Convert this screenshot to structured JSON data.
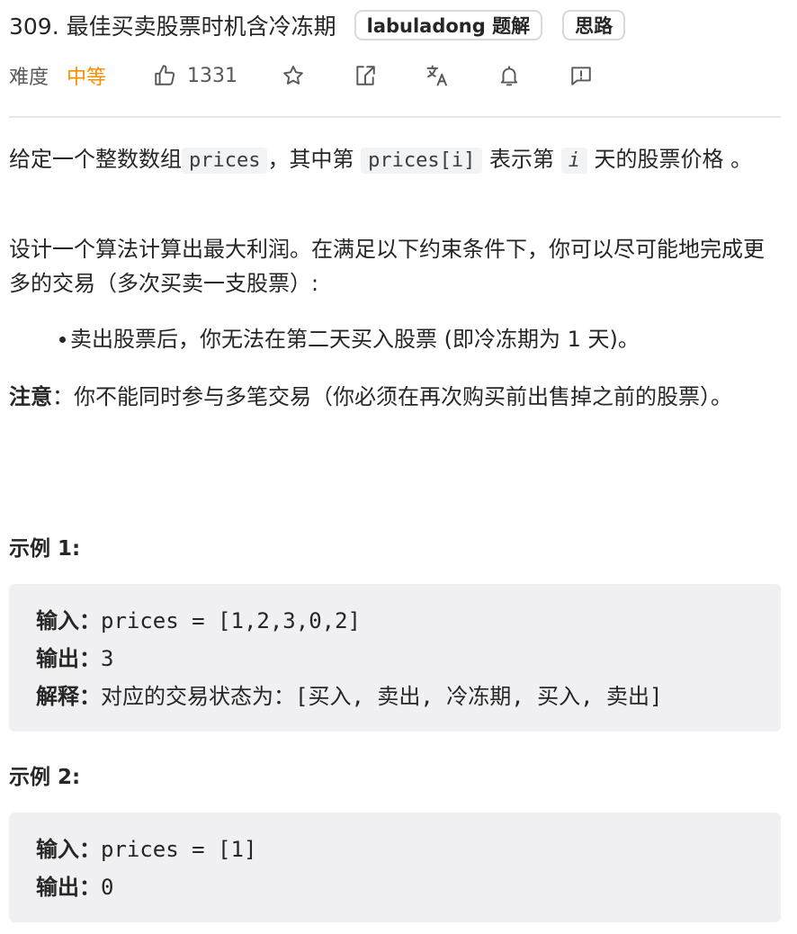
{
  "problem": {
    "title": "309. 最佳买卖股票时机含冷冻期",
    "tags": [
      "labuladong 题解",
      "思路"
    ]
  },
  "meta": {
    "difficulty_label": "难度",
    "difficulty": "中等",
    "likes": "1331",
    "accent_color": "#ff8d00",
    "icons": [
      "thumbs-up-icon",
      "star-icon",
      "share-icon",
      "translate-icon",
      "bell-icon",
      "feedback-icon"
    ]
  },
  "description": {
    "p1_text1": "给定一个整数数组",
    "p1_code1": "prices",
    "p1_text2": "，其中第 ",
    "p1_code2": "prices[i]",
    "p1_text3": " 表示第 ",
    "p1_code3": "i",
    "p1_text4": " 天的股票价格 。",
    "p2": "设计一个算法计算出最大利润。在满足以下约束条件下，你可以尽可能地完成更多的交易（多次买卖一支股票）:",
    "bullet1": "卖出股票后，你无法在第二天买入股票 (即冷冻期为 1 天)。",
    "note_label": "注意",
    "note_text": "：你不能同时参与多笔交易（你必须在再次购买前出售掉之前的股票）。"
  },
  "examples": [
    {
      "title": "示例 1:",
      "input_label": "输入：",
      "input": "prices = [1,2,3,0,2]",
      "output_label": "输出：",
      "output": "3",
      "explain_label": "解释：",
      "explain": "对应的交易状态为：[买入, 卖出, 冷冻期, 买入, 卖出]"
    },
    {
      "title": "示例 2:",
      "input_label": "输入：",
      "input": "prices = [1]",
      "output_label": "输出：",
      "output": "0"
    }
  ]
}
